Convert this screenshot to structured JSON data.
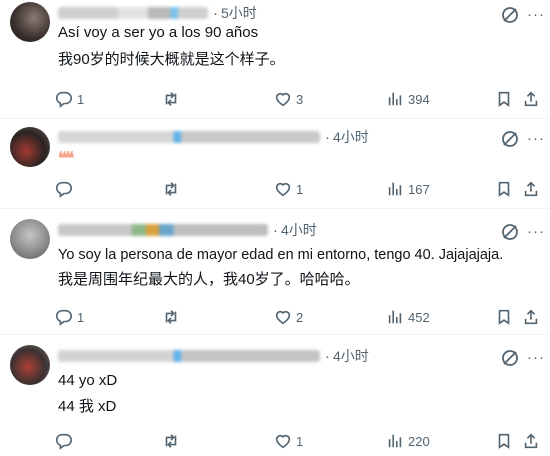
{
  "replies": [
    {
      "time": "5小时",
      "lines": [
        "Así voy a ser yo a los 90 años",
        "我90岁的时候大概就是这个样子。"
      ],
      "stats": {
        "replies": "1",
        "reposts": "",
        "likes": "3",
        "views": "394"
      },
      "avatar_colors": [
        "#3a2f2c",
        "#8a7a72",
        "#1d1a19"
      ],
      "name_colors": [
        "#c9c9c9",
        "#dcdcdc",
        "#b7b7b7"
      ]
    },
    {
      "time": "4小时",
      "emoji": "❝❝",
      "lines": [],
      "stats": {
        "replies": "",
        "reposts": "",
        "likes": "1",
        "views": "167"
      },
      "avatar_colors": [
        "#2a2322",
        "#a33b33",
        "#6b6160"
      ],
      "name_colors": [
        "#d6d6d6",
        "#62b3ea",
        "#c8c8c8"
      ]
    },
    {
      "time": "4小时",
      "lines": [
        "Yo soy la persona de mayor edad en mi entorno, tengo 40. Jajajajaja.",
        "我是周围年纪最大的人，我40岁了。哈哈哈。"
      ],
      "stats": {
        "replies": "1",
        "reposts": "",
        "likes": "2",
        "views": "452"
      },
      "avatar_colors": [
        "#8c8c8c",
        "#c5c5c5",
        "#5a5a5a"
      ],
      "name_colors": [
        "#c7c7c7",
        "#d9a23e",
        "#6aa5c9"
      ]
    },
    {
      "time": "4小时",
      "lines": [
        "44 yo xD",
        "44 我 xD"
      ],
      "stats": {
        "replies": "",
        "reposts": "",
        "likes": "1",
        "views": "220"
      },
      "avatar_colors": [
        "#3a3130",
        "#b04038",
        "#7a6f6c"
      ],
      "name_colors": [
        "#d3d3d3",
        "#5fb2ea",
        "#c4c4c4"
      ]
    }
  ],
  "colors": {
    "muted": "#536471",
    "divider": "#eff3f4",
    "text": "#0f1419"
  },
  "icons": [
    "reply-icon",
    "repost-icon",
    "like-icon",
    "views-icon",
    "bookmark-icon",
    "share-icon",
    "grok-icon",
    "more-icon"
  ]
}
